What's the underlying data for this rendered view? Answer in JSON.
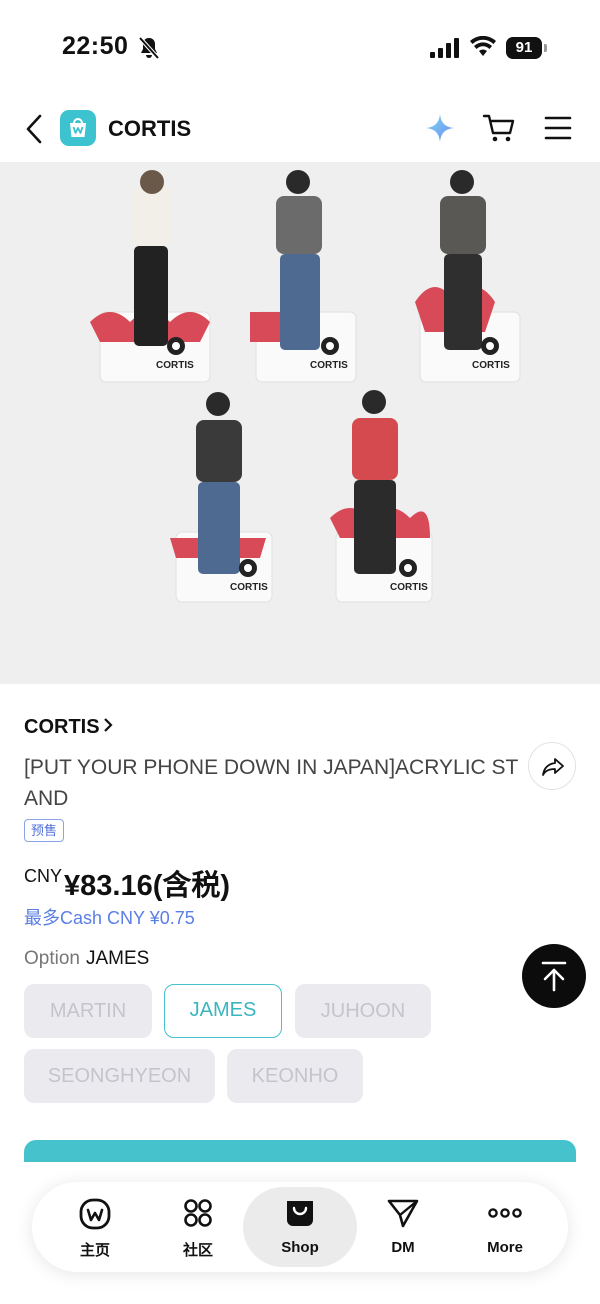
{
  "status_bar": {
    "time": "22:50",
    "battery": "91"
  },
  "header": {
    "title": "CORTIS",
    "logo_icon": "weverse-shop-bag-icon"
  },
  "product": {
    "artist": "CORTIS",
    "title": "[PUT YOUR PHONE DOWN IN JAPAN]ACRYLIC STAND",
    "badge": "预售",
    "price_currency": "CNY",
    "price": "¥83.16(含税)",
    "cash_reward": "最多Cash CNY ¥0.75",
    "stand_brand": "CORTIS"
  },
  "options": {
    "label": "Option",
    "selected": "JAMES",
    "items": [
      "MARTIN",
      "JAMES",
      "JUHOON",
      "SEONGHYEON",
      "KEONHO"
    ]
  },
  "bottom_nav": {
    "items": [
      {
        "label": "主页",
        "icon": "weverse-home-icon"
      },
      {
        "label": "社区",
        "icon": "community-grid-icon"
      },
      {
        "label": "Shop",
        "icon": "shopping-bag-icon"
      },
      {
        "label": "DM",
        "icon": "paper-plane-icon"
      },
      {
        "label": "More",
        "icon": "more-dots-icon"
      }
    ],
    "active": "Shop"
  },
  "colors": {
    "accent": "#45c2cb",
    "link_blue": "#5b7ee5"
  }
}
